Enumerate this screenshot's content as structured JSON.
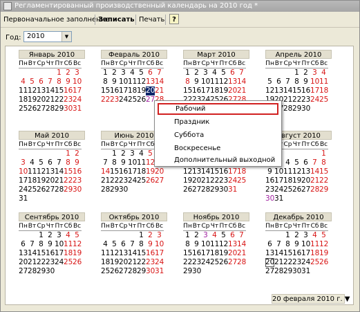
{
  "window": {
    "title": "Регламентированный производственный календарь на 2010 год *"
  },
  "toolbar": {
    "fill_label": "Первоначальное заполнение",
    "save_label": "Записать",
    "print_label": "Печать",
    "help_label": "?"
  },
  "year": {
    "label": "Год:",
    "value": "2010"
  },
  "weekdays": [
    "Пн",
    "Вт",
    "Ср",
    "Чт",
    "Пт",
    "Сб",
    "Вс"
  ],
  "months": [
    {
      "name": "Январь 2010",
      "start": 4,
      "days": 31,
      "hol": [
        1,
        2,
        3,
        4,
        5,
        6,
        7,
        8,
        9,
        10,
        16,
        17,
        23,
        24,
        30,
        31
      ],
      "pre": []
    },
    {
      "name": "Февраль 2010",
      "start": 0,
      "days": 28,
      "hol": [
        6,
        7,
        13,
        14,
        21,
        22,
        23,
        28
      ],
      "pre": [
        27
      ],
      "sel": 20
    },
    {
      "name": "Март 2010",
      "start": 0,
      "days": 31,
      "hol": [
        6,
        7,
        8,
        13,
        14,
        20,
        21,
        27,
        28
      ],
      "pre": []
    },
    {
      "name": "Апрель 2010",
      "start": 3,
      "days": 30,
      "hol": [
        3,
        4,
        10,
        11,
        17,
        18,
        24,
        25
      ],
      "pre": []
    },
    {
      "name": "Май 2010",
      "start": 5,
      "days": 31,
      "hol": [
        1,
        2,
        3,
        8,
        9,
        10,
        15,
        16,
        22,
        23,
        29,
        30
      ],
      "pre": []
    },
    {
      "name": "Июнь 2010",
      "start": 1,
      "days": 30,
      "hol": [
        5,
        6,
        12,
        13,
        14,
        19,
        20,
        26,
        27
      ],
      "pre": []
    },
    {
      "name": "Июль 2010",
      "start": 3,
      "days": 31,
      "hol": [
        3,
        4,
        10,
        11,
        17,
        18,
        24,
        25,
        31
      ],
      "pre": []
    },
    {
      "name": "Август 2010",
      "start": 6,
      "days": 31,
      "hol": [
        1,
        7,
        8,
        14,
        15,
        21,
        22,
        28,
        29
      ],
      "pre": [
        30
      ]
    },
    {
      "name": "Сентябрь 2010",
      "start": 2,
      "days": 30,
      "hol": [
        4,
        5,
        11,
        12,
        18,
        19,
        25,
        26
      ],
      "pre": []
    },
    {
      "name": "Октябрь 2010",
      "start": 4,
      "days": 31,
      "hol": [
        2,
        3,
        9,
        10,
        16,
        17,
        23,
        24,
        30,
        31
      ],
      "pre": []
    },
    {
      "name": "Ноябрь 2010",
      "start": 0,
      "days": 30,
      "hol": [
        4,
        6,
        7,
        13,
        14,
        20,
        21,
        27,
        28
      ],
      "pre": [
        3
      ]
    },
    {
      "name": "Декабрь 2010",
      "start": 2,
      "days": 31,
      "hol": [
        4,
        5,
        11,
        12,
        18,
        19,
        25,
        26
      ],
      "pre": [],
      "today": 20
    }
  ],
  "context_menu": {
    "items": [
      "Рабочий",
      "Праздник",
      "Суббота",
      "Воскресенье",
      "Дополнительный выходной"
    ]
  },
  "status": {
    "current_date": "20 февраля 2010 г. ▼"
  },
  "colors": {
    "holiday": "#d81414",
    "preholiday": "#a020a0",
    "selected": "#0a246a"
  }
}
